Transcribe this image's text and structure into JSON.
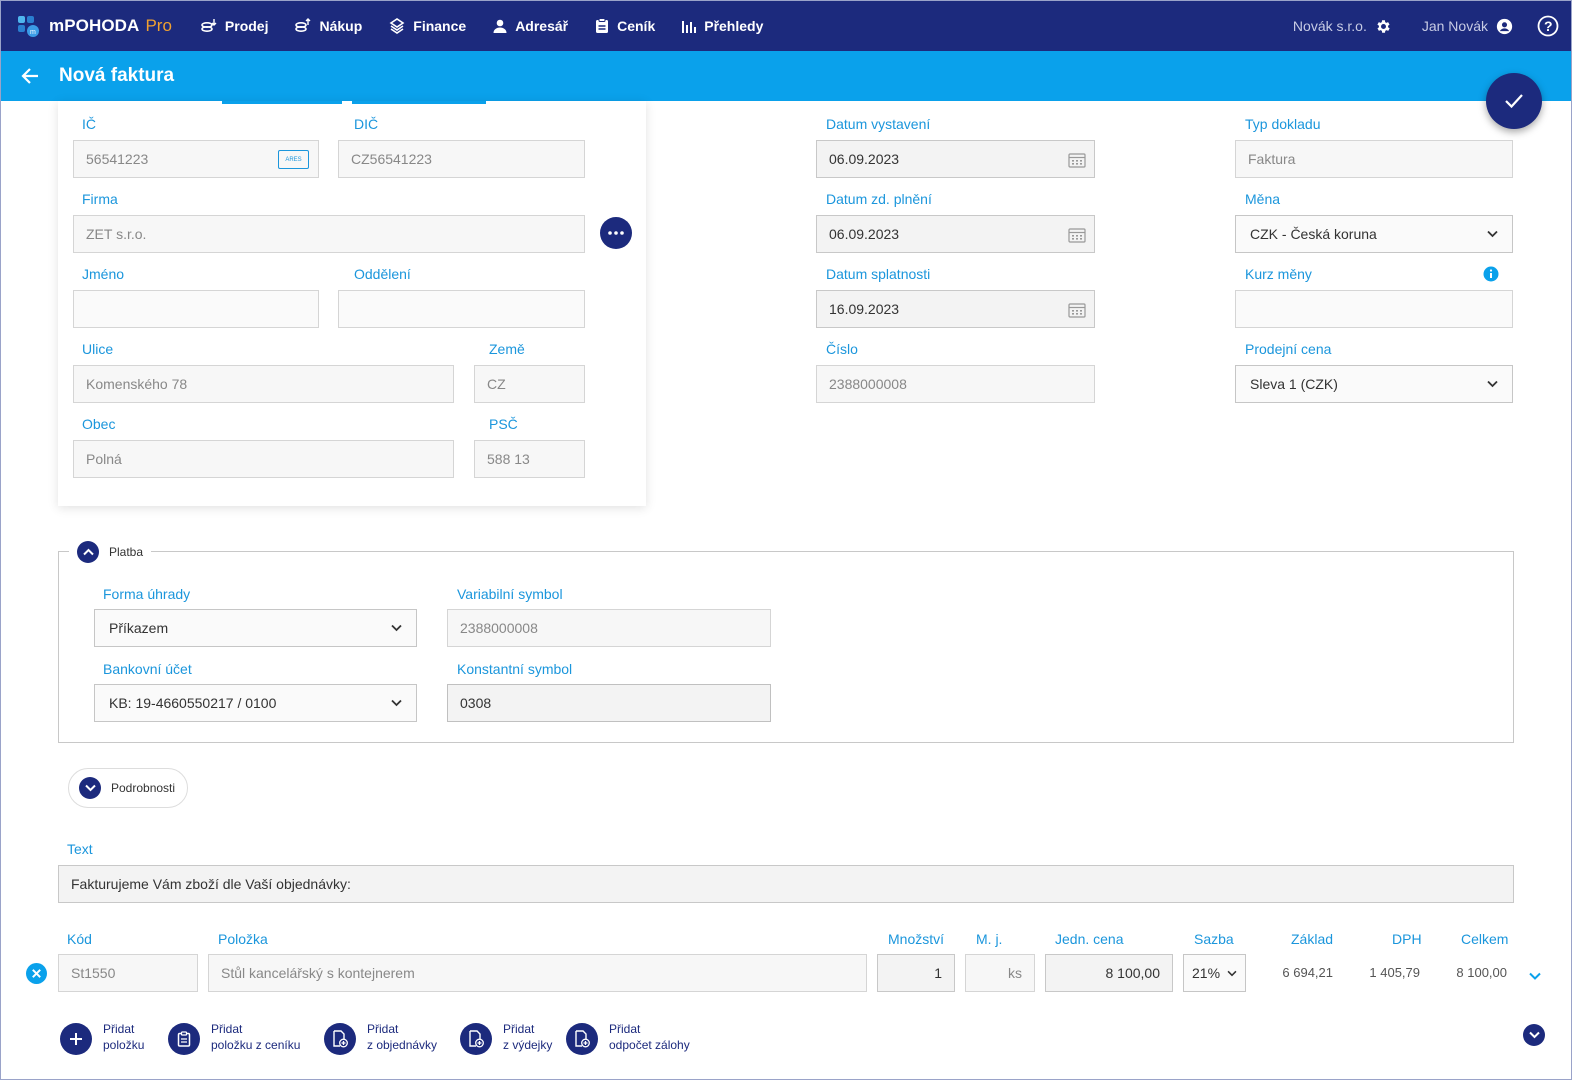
{
  "app": {
    "name": "mPOHODA",
    "edition": "Pro"
  },
  "nav": [
    {
      "label": "Prodej"
    },
    {
      "label": "Nákup"
    },
    {
      "label": "Finance"
    },
    {
      "label": "Adresář"
    },
    {
      "label": "Ceník"
    },
    {
      "label": "Přehledy"
    }
  ],
  "account": {
    "company": "Novák s.r.o.",
    "user": "Jan Novák"
  },
  "page": {
    "title": "Nová faktura"
  },
  "partner": {
    "ic": {
      "label": "IČ",
      "value": "56541223",
      "ares": "ARES"
    },
    "dic": {
      "label": "DIČ",
      "value": "CZ56541223"
    },
    "firma": {
      "label": "Firma",
      "value": "ZET s.r.o."
    },
    "jmeno": {
      "label": "Jméno",
      "value": ""
    },
    "oddeleni": {
      "label": "Oddělení",
      "value": ""
    },
    "ulice": {
      "label": "Ulice",
      "value": "Komenského 78"
    },
    "zeme": {
      "label": "Země",
      "value": "CZ"
    },
    "obec": {
      "label": "Obec",
      "value": "Polná"
    },
    "psc": {
      "label": "PSČ",
      "value": "588 13"
    }
  },
  "document": {
    "datum_vystaveni": {
      "label": "Datum vystavení",
      "value": "06.09.2023"
    },
    "datum_zd_plneni": {
      "label": "Datum zd. plnění",
      "value": "06.09.2023"
    },
    "datum_splatnosti": {
      "label": "Datum splatnosti",
      "value": "16.09.2023"
    },
    "cislo": {
      "label": "Číslo",
      "value": "2388000008"
    },
    "typ_dokladu": {
      "label": "Typ dokladu",
      "value": "Faktura"
    },
    "mena": {
      "label": "Měna",
      "value": "CZK - Česká koruna"
    },
    "kurz_meny": {
      "label": "Kurz měny",
      "value": ""
    },
    "prodejni_cena": {
      "label": "Prodejní cena",
      "value": "Sleva 1 (CZK)"
    }
  },
  "platba": {
    "title": "Platba",
    "forma_uhrady": {
      "label": "Forma úhrady",
      "value": "Příkazem"
    },
    "variabilni_symbol": {
      "label": "Variabilní symbol",
      "value": "2388000008"
    },
    "bankovni_ucet": {
      "label": "Bankovní účet",
      "value": "KB: 19-4660550217 / 0100"
    },
    "konstantni_symbol": {
      "label": "Konstantní symbol",
      "value": "0308"
    }
  },
  "podrobnosti": {
    "label": "Podrobnosti"
  },
  "text": {
    "label": "Text",
    "value": "Fakturujeme Vám zboží dle Vaší objednávky:"
  },
  "items": {
    "headers": {
      "kod": "Kód",
      "polozka": "Položka",
      "mnozstvi": "Množství",
      "mj": "M. j.",
      "jedn_cena": "Jedn. cena",
      "sazba": "Sazba",
      "zaklad": "Základ",
      "dph": "DPH",
      "celkem": "Celkem"
    },
    "rows": [
      {
        "kod": "St1550",
        "polozka": "Stůl kancelářský s kontejnerem",
        "mnozstvi": "1",
        "mj": "ks",
        "jedn_cena": "8 100,00",
        "sazba": "21%",
        "zaklad": "6 694,21",
        "dph": "1 405,79",
        "celkem": "8 100,00"
      }
    ]
  },
  "actions": [
    {
      "line1": "Přidat",
      "line2": "položku"
    },
    {
      "line1": "Přidat",
      "line2": "položku z ceníku"
    },
    {
      "line1": "Přidat",
      "line2": "z objednávky"
    },
    {
      "line1": "Přidat",
      "line2": "z výdejky"
    },
    {
      "line1": "Přidat",
      "line2": "odpočet zálohy"
    }
  ],
  "colors": {
    "navbar": "#1c2a7d",
    "header": "#0aa1eb",
    "label": "#1b96dc",
    "accent_orange": "#f0a030"
  }
}
